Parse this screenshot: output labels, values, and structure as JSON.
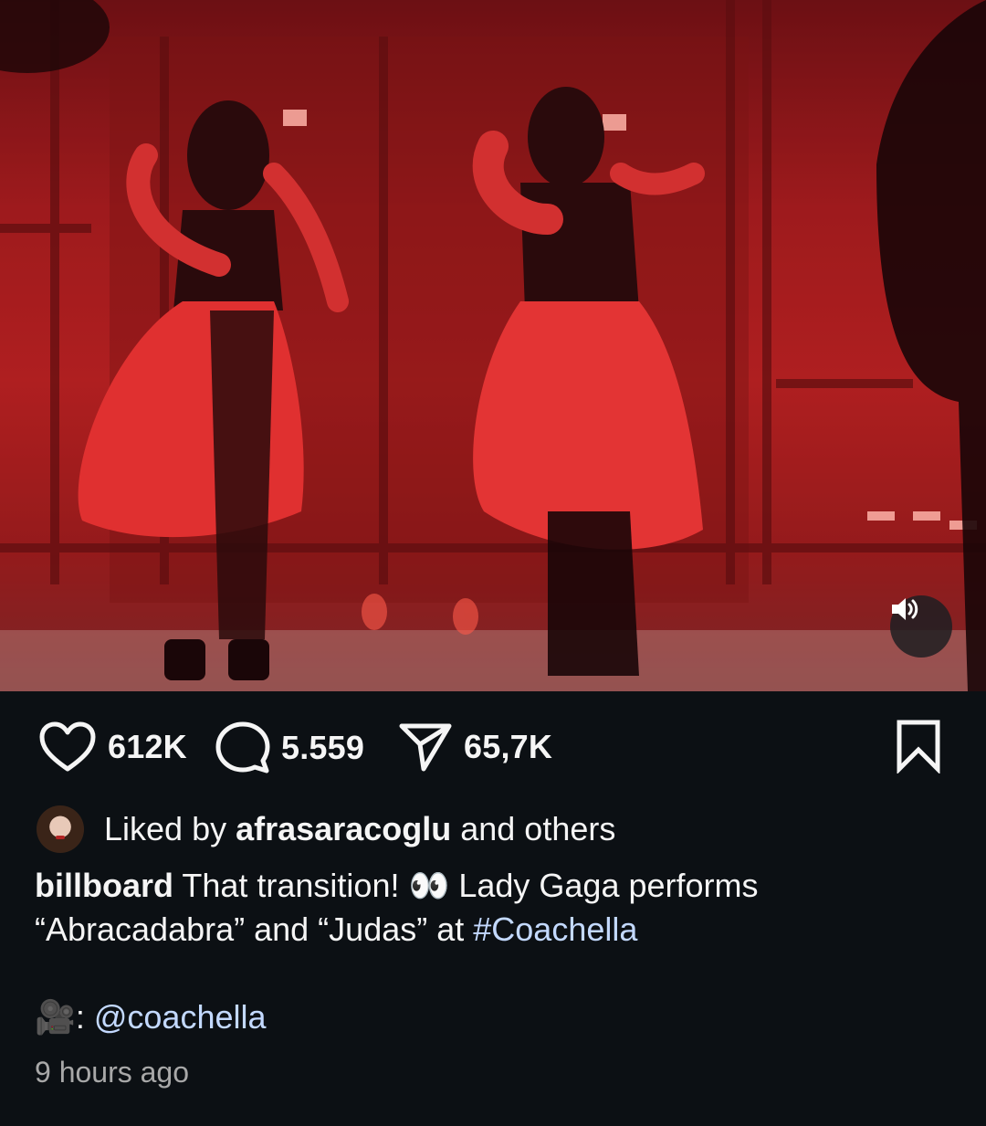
{
  "post": {
    "media": {
      "description_icon": "speaker-on-icon"
    },
    "actions": {
      "likes": "612K",
      "comments": "5.559",
      "shares": "65,7K",
      "like_icon": "heart-icon",
      "comment_icon": "comment-icon",
      "share_icon": "send-icon",
      "save_icon": "bookmark-icon"
    },
    "liked_by": {
      "prefix": "Liked by",
      "user": "afrasaracoglu",
      "suffix": "and others"
    },
    "caption": {
      "author": "billboard",
      "text_1": "That transition!",
      "emoji": "👀",
      "text_2": "Lady Gaga performs “Abracadabra” and “Judas” at",
      "hashtag": "#Coachella",
      "credit_emoji": "🎥",
      "credit_sep": ":",
      "credit_mention": "@coachella"
    },
    "timestamp": "9 hours ago"
  },
  "colors": {
    "background": "#0c1014",
    "text": "#f5f5f5",
    "link": "#c3d9ff",
    "muted": "#a8a8a8"
  }
}
